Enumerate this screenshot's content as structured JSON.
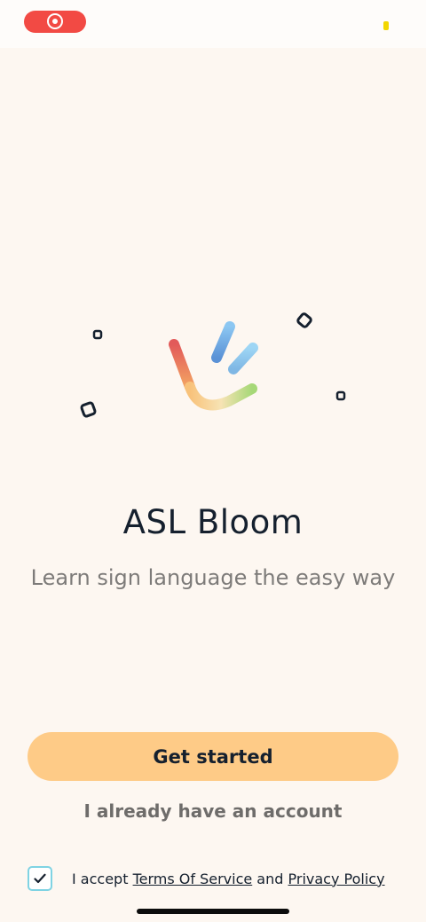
{
  "app": {
    "title": "ASL Bloom",
    "subtitle": "Learn sign language the easy way",
    "logo_icon": "colorful-hand-icon"
  },
  "actions": {
    "get_started_label": "Get started",
    "login_label": "I already have an account"
  },
  "terms": {
    "checked": true,
    "prefix": "I accept ",
    "terms_link": "Terms Of Service",
    "conjunction": " and ",
    "privacy_link": "Privacy Policy"
  },
  "colors": {
    "background": "#fdf7f1",
    "primary_button": "#fecb87",
    "text_dark": "#15202e",
    "text_muted": "#7d7b79",
    "checkbox_border": "#7fd3e3",
    "record_pill": "#f24a44"
  }
}
